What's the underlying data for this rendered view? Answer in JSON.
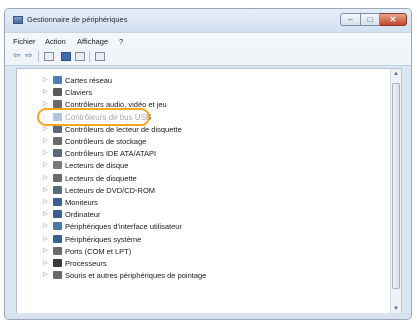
{
  "window": {
    "title": "Gestionnaire de périphériques",
    "controls": {
      "minimize": "–",
      "maximize": "□",
      "close": "✕"
    }
  },
  "menu": [
    "Fichier",
    "Action",
    "Affichage",
    "?"
  ],
  "toolbar": {
    "back": "⇦",
    "forward": "⇨"
  },
  "tree": {
    "items": [
      {
        "label": "Cartes réseau",
        "icon": "network-adapter-icon",
        "color": "#4a7fb5"
      },
      {
        "label": "Claviers",
        "icon": "keyboard-icon",
        "color": "#5a5a5a"
      },
      {
        "label": "Contrôleurs audio, vidéo et jeu",
        "icon": "audio-icon",
        "color": "#6a6a6a"
      },
      {
        "label": "Contrôleurs de bus USB",
        "icon": "usb-icon",
        "color": "#3a6fb0"
      },
      {
        "label": "Contrôleurs de lecteur de disquette",
        "icon": "floppy-controller-icon",
        "color": "#5a6a7a"
      },
      {
        "label": "Contrôleurs de stockage",
        "icon": "storage-controller-icon",
        "color": "#6a6a6a"
      },
      {
        "label": "Contrôleurs IDE ATA/ATAPI",
        "icon": "ide-controller-icon",
        "color": "#5a6a7a"
      },
      {
        "label": "Lecteurs de disque",
        "icon": "disk-drive-icon",
        "color": "#7a7a7a"
      },
      {
        "label": "Lecteurs de disquette",
        "icon": "floppy-drive-icon",
        "color": "#6a6a6a"
      },
      {
        "label": "Lecteurs de DVD/CD-ROM",
        "icon": "dvd-drive-icon",
        "color": "#5a6a7a"
      },
      {
        "label": "Moniteurs",
        "icon": "monitor-icon",
        "color": "#3a5f90"
      },
      {
        "label": "Ordinateur",
        "icon": "computer-icon",
        "color": "#3a5f90"
      },
      {
        "label": "Périphériques d'interface utilisateur",
        "icon": "hid-icon",
        "color": "#4a7aa0"
      },
      {
        "label": "Périphériques système",
        "icon": "system-devices-icon",
        "color": "#3a5f90"
      },
      {
        "label": "Ports (COM et LPT)",
        "icon": "port-icon",
        "color": "#6a6a6a"
      },
      {
        "label": "Processeurs",
        "icon": "processor-icon",
        "color": "#3a3a3a"
      },
      {
        "label": "Souris et autres périphériques de pointage",
        "icon": "mouse-icon",
        "color": "#6a6a6a"
      }
    ],
    "highlighted_index": 3
  },
  "highlight_color": "#f5a623"
}
